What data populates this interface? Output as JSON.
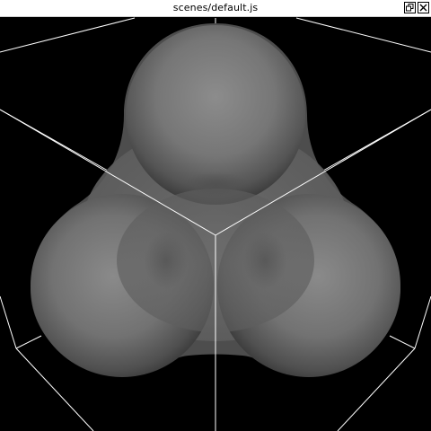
{
  "window": {
    "title": "scenes/default.js",
    "buttons": {
      "restore_icon": "restore-window-icon",
      "close_icon": "close-window-icon"
    }
  },
  "scene": {
    "background_color": "#000000",
    "wireframe_color": "#ffffff",
    "surface_color_center": "#8a8a8a",
    "surface_color_edge": "#2a2a2a",
    "object": "three-lobed blobby surface",
    "guides": "cube wireframe edges"
  }
}
